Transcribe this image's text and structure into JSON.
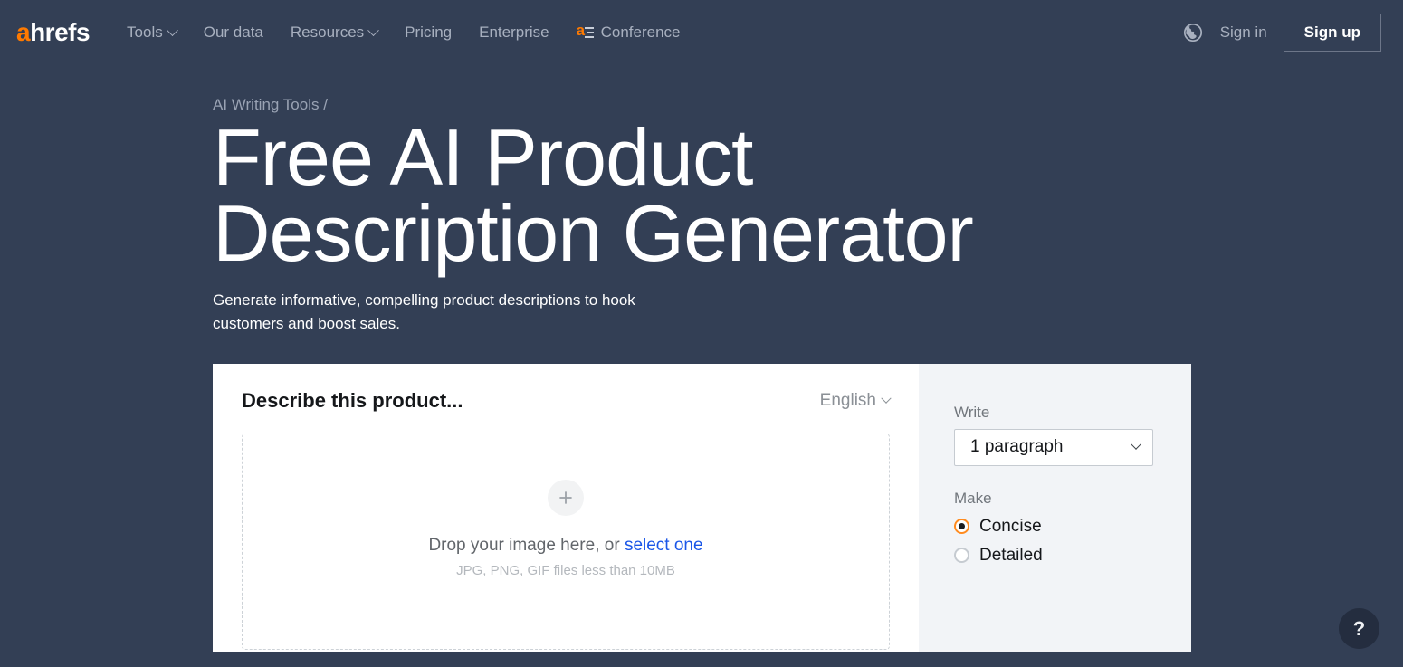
{
  "colors": {
    "page_background": "#333f55",
    "brand_orange": "#ff7a00",
    "link_blue": "#1a56e8",
    "radio_accent": "#ff8b1f",
    "card_background": "#ffffff",
    "sidebar_background": "#f2f4f7"
  },
  "header": {
    "brand": {
      "accent_letter": "a",
      "rest": "hrefs"
    },
    "nav": [
      {
        "label": "Tools",
        "has_chevron": true,
        "icon": null
      },
      {
        "label": "Our data",
        "has_chevron": false,
        "icon": null
      },
      {
        "label": "Resources",
        "has_chevron": true,
        "icon": null
      },
      {
        "label": "Pricing",
        "has_chevron": false,
        "icon": null
      },
      {
        "label": "Enterprise",
        "has_chevron": false,
        "icon": null
      },
      {
        "label": "Conference",
        "has_chevron": false,
        "icon": "ahrefs-conference-icon"
      }
    ],
    "language_globe_icon": "globe-icon",
    "sign_in_label": "Sign in",
    "sign_up_label": "Sign up"
  },
  "hero": {
    "breadcrumb": "AI Writing Tools /",
    "title": "Free AI Product Description Generator",
    "subtitle": "Generate informative, compelling product descriptions to hook customers and boost sales."
  },
  "tool": {
    "card_title": "Describe this product...",
    "language": {
      "selected": "English",
      "chevron_icon": "chevron-down-icon"
    },
    "dropzone": {
      "plus_icon": "plus-icon",
      "prompt_prefix": "Drop your image here, or ",
      "prompt_link": "select one",
      "hint": "JPG, PNG, GIF files less than 10MB"
    },
    "sidebar": {
      "write_label": "Write",
      "write_value": "1 paragraph",
      "write_chevron_icon": "chevron-down-icon",
      "make_label": "Make",
      "make_options": [
        {
          "label": "Concise",
          "selected": true
        },
        {
          "label": "Detailed",
          "selected": false
        }
      ]
    }
  },
  "help": {
    "label": "?"
  }
}
